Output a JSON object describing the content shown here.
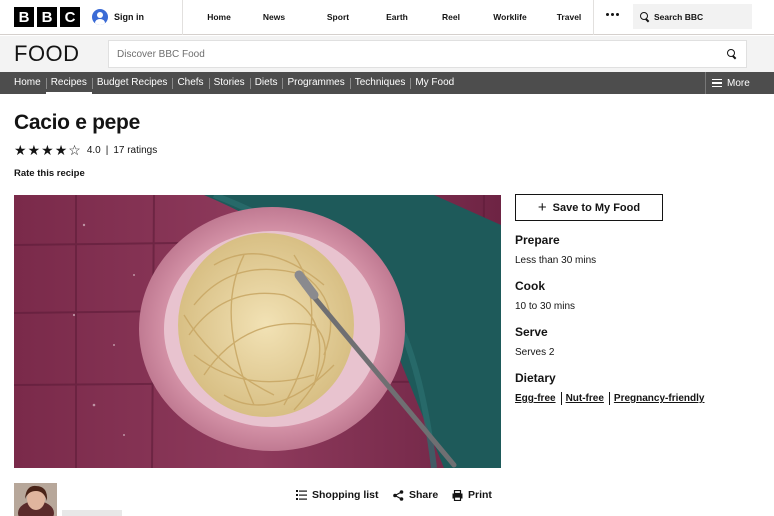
{
  "bbc": {
    "logo_letters": [
      "B",
      "B",
      "C"
    ],
    "signin_label": "Sign in",
    "nav": [
      "Home",
      "News",
      "Sport",
      "Earth",
      "Reel",
      "Worklife",
      "Travel"
    ],
    "search_label": "Search BBC"
  },
  "food": {
    "logo": "FOOD",
    "search_placeholder": "Discover BBC Food"
  },
  "section_nav": {
    "items": [
      "Home",
      "Recipes",
      "Budget Recipes",
      "Chefs",
      "Stories",
      "Diets",
      "Programmes",
      "Techniques",
      "My Food"
    ],
    "active": "Recipes",
    "more_label": "More"
  },
  "recipe": {
    "title": "Cacio e pepe",
    "rating_value": "4.0",
    "rating_separator": "|",
    "rating_count": "17 ratings",
    "stars_filled": 4,
    "stars_total": 5,
    "rate_label": "Rate this recipe"
  },
  "sidebar": {
    "save_label": "Save to My Food",
    "prepare_heading": "Prepare",
    "prepare_value": "Less than 30 mins",
    "cook_heading": "Cook",
    "cook_value": "10 to 30 mins",
    "serve_heading": "Serve",
    "serve_value": "Serves 2",
    "dietary_heading": "Dietary",
    "dietary_tags": [
      "Egg-free",
      "Nut-free",
      "Pregnancy-friendly"
    ]
  },
  "actions": {
    "shopping_list": "Shopping list",
    "share": "Share",
    "print": "Print"
  },
  "colors": {
    "section_nav_bg": "#4d4d4d",
    "header_bg": "#f3f3f3",
    "text": "#141414"
  }
}
